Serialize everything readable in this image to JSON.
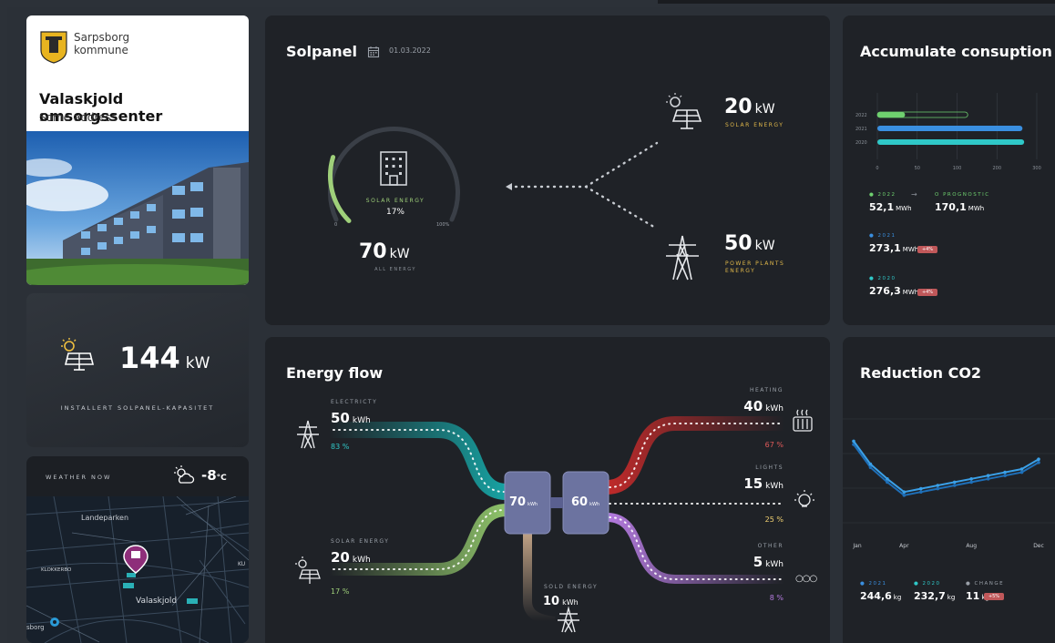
{
  "header": {
    "municipality_line1": "Sarpsborg",
    "municipality_line2": "kommune",
    "place_name": "Valaskjold omsorgssenter",
    "address": "Some address"
  },
  "capacity": {
    "value": "144",
    "unit": "kW",
    "label": "INSTALLERT SOLPANEL-KAPASITET"
  },
  "weather": {
    "label": "WEATHER NOW",
    "temp": "-8",
    "temp_unit": "°C",
    "icon": "partly-cloudy-icon",
    "map_labels": [
      "Landeparken",
      "KLOKKERBO",
      "Valaskjold",
      "sborg",
      "KU"
    ]
  },
  "solpanel": {
    "title": "Solpanel",
    "date": "01.03.2022",
    "gauge_label": "SOLAR ENERGY",
    "gauge_percent": "17%",
    "gauge_value": 17,
    "gauge_min": "0",
    "gauge_max": "100%",
    "all_energy_value": "70",
    "all_energy_unit": "kW",
    "all_energy_label": "ALL ENERGY",
    "solar_value": "20",
    "solar_unit": "kW",
    "solar_label": "SOLAR ENERGY",
    "plants_value": "50",
    "plants_unit": "kW",
    "plants_label_1": "POWER PLANTS",
    "plants_label_2": "ENERGY",
    "accent_color": "#9fd07a",
    "label_color": "#e0b84a"
  },
  "accumulate": {
    "title": "Accumulate consuption",
    "chart_data": {
      "type": "bar",
      "orientation": "horizontal",
      "categories": [
        "2022",
        "2021",
        "2020"
      ],
      "values": [
        52.1,
        273.1,
        276.3
      ],
      "prognostic": 170.1,
      "xticks": [
        "0",
        "50",
        "100",
        "200",
        "300"
      ],
      "xlim": [
        0,
        300
      ]
    },
    "stats": [
      {
        "year": "2022",
        "value": "52,1",
        "unit": "MWh",
        "color": "#6fd06f"
      },
      {
        "year": "2021",
        "value": "273,1",
        "unit": "MWh",
        "color": "#3a8fe0",
        "tag": "+4%"
      },
      {
        "year": "2020",
        "value": "276,3",
        "unit": "MWh",
        "color": "#2fc8c8",
        "tag": "+4%"
      }
    ],
    "arrow": "→",
    "prognostic_label": "O PROGNOSTIC",
    "prognostic_value": "170,1",
    "prognostic_unit": "MWh"
  },
  "flow": {
    "title": "Energy flow",
    "electricity": {
      "label": "ELECTRICTY",
      "value": "50",
      "unit": "kWh",
      "pct": "83 %"
    },
    "solar": {
      "label": "SOLAR ENERGY",
      "value": "20",
      "unit": "kWh",
      "pct": "17 %"
    },
    "sold": {
      "label": "SOLD ENERGY",
      "value": "10",
      "unit": "kWh"
    },
    "heating": {
      "label": "HEATING",
      "value": "40",
      "unit": "kWh",
      "pct": "67 %"
    },
    "lights": {
      "label": "LIGHTS",
      "value": "15",
      "unit": "kWh",
      "pct": "25 %"
    },
    "other": {
      "label": "OTHER",
      "value": "5",
      "unit": "kWh",
      "pct": "8 %"
    },
    "hub_in_value": "70",
    "hub_in_unit": "kWh",
    "hub_out_value": "60",
    "hub_out_unit": "kWh",
    "other_glyph": "○○○"
  },
  "reduction": {
    "title": "Reduction CO2",
    "chart_data": {
      "type": "line",
      "x": [
        "Jan",
        "Feb",
        "Mar",
        "Apr",
        "May",
        "Jun",
        "Jul",
        "Aug",
        "Sep",
        "Oct",
        "Nov",
        "Dec"
      ],
      "series": [
        {
          "values": [
            80,
            52,
            34,
            18,
            22,
            26,
            30,
            34,
            38,
            42,
            46,
            58
          ]
        },
        {
          "values": [
            84,
            56,
            38,
            22,
            26,
            30,
            34,
            38,
            42,
            46,
            50,
            62
          ]
        }
      ],
      "xticks": [
        "Jan",
        "Apr",
        "Aug",
        "Dec"
      ]
    },
    "stats": [
      {
        "label": "2021",
        "value": "244,6",
        "unit": "kg",
        "color": "#3a8fe0"
      },
      {
        "label": "2020",
        "value": "232,7",
        "unit": "kg",
        "color": "#2fc8c8"
      },
      {
        "label": "CHANGE",
        "value": "11",
        "unit": "kg",
        "color": "#9aa0a8",
        "tag": "+5%"
      }
    ]
  }
}
